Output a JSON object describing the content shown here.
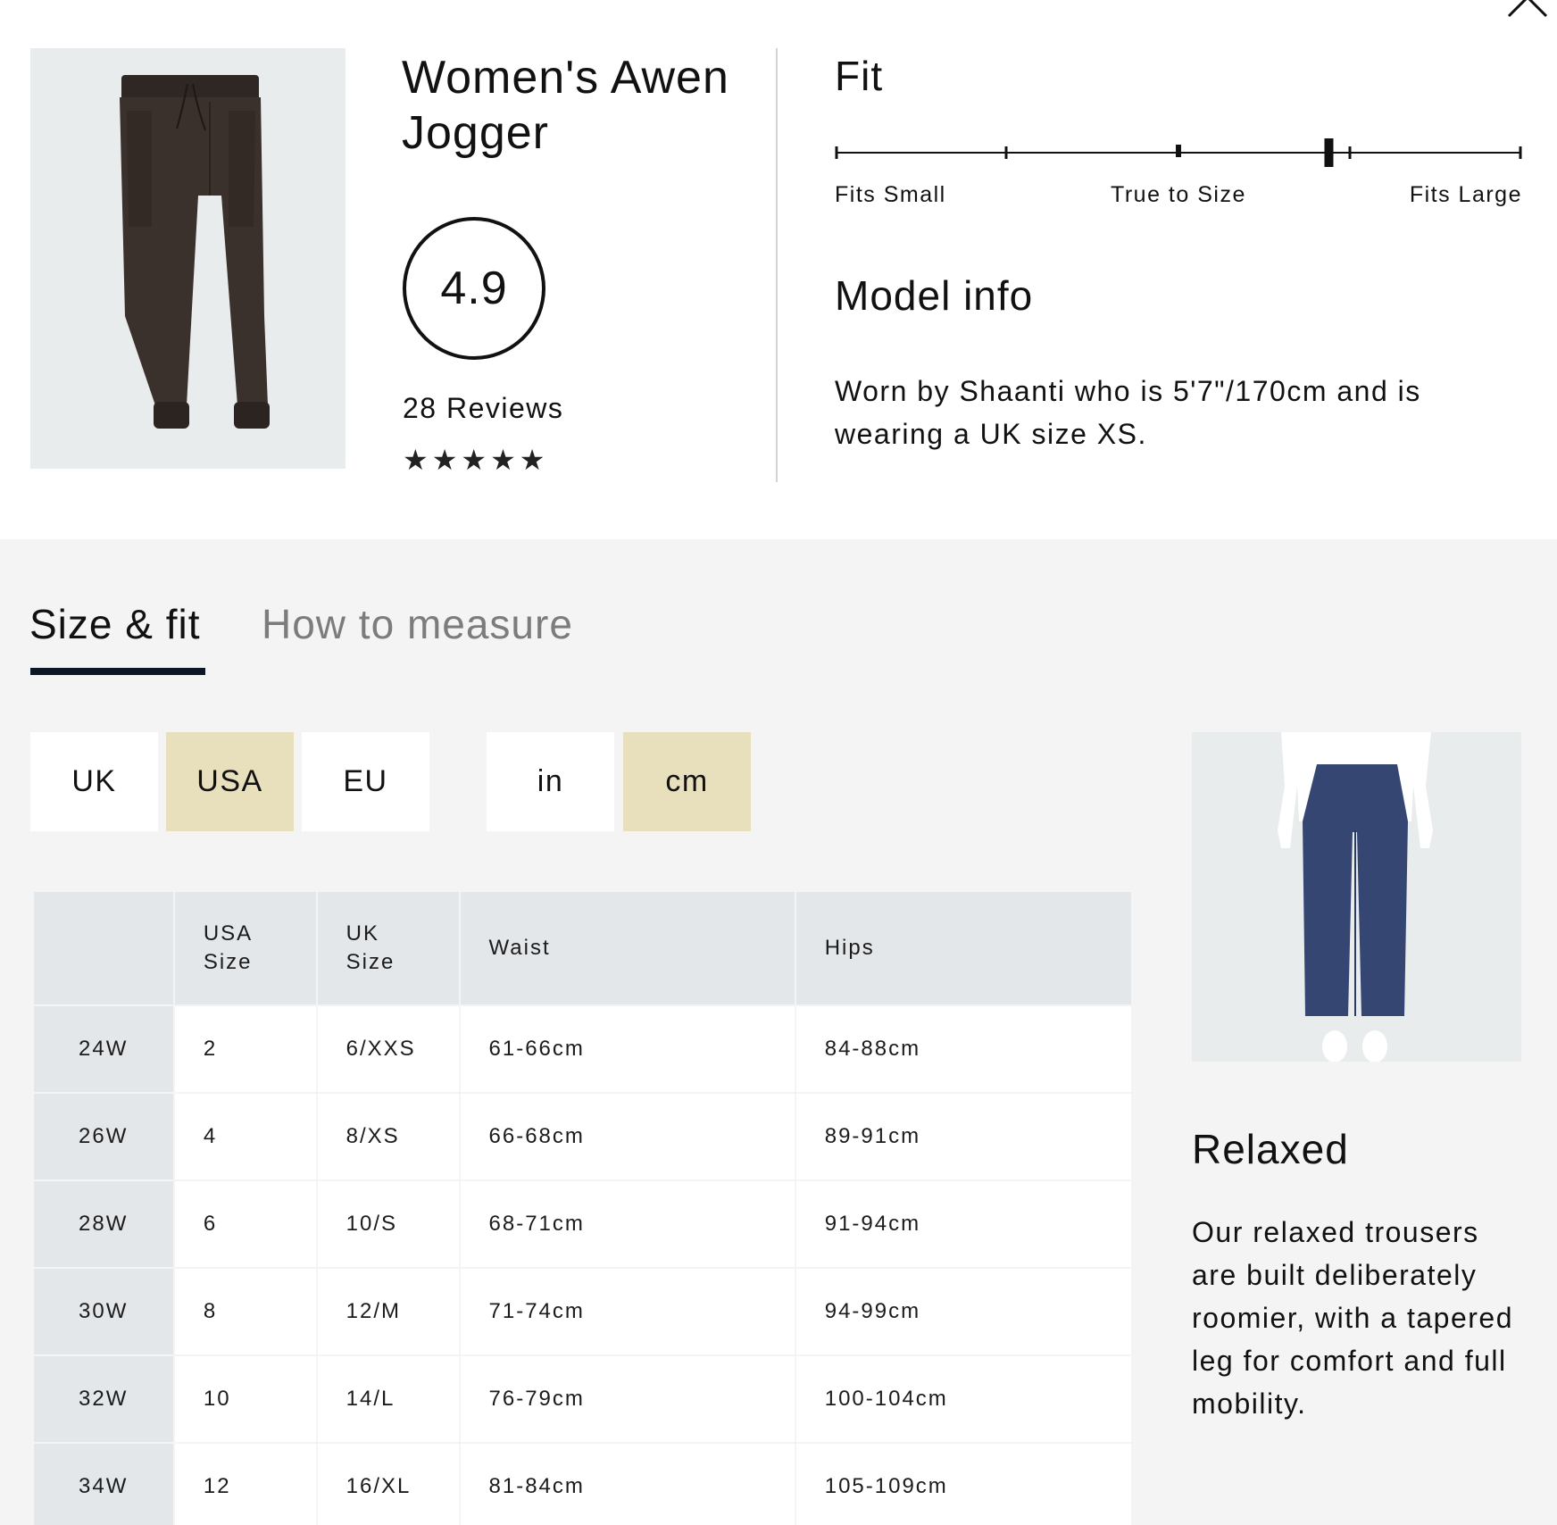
{
  "product": {
    "title": "Women's Awen Jogger",
    "rating": "4.9",
    "review_count": "28 Reviews",
    "stars": 5
  },
  "fit": {
    "heading": "Fit",
    "labels": [
      "Fits Small",
      "True to Size",
      "Fits Large"
    ],
    "position": 0.72
  },
  "model": {
    "heading": "Model info",
    "text": "Worn by Shaanti who is 5'7\"/170cm and is wearing a UK size XS."
  },
  "tabs": [
    {
      "label": "Size & fit",
      "active": true
    },
    {
      "label": "How to measure",
      "active": false
    }
  ],
  "region_toggles": [
    {
      "label": "UK",
      "active": false
    },
    {
      "label": "USA",
      "active": true
    },
    {
      "label": "EU",
      "active": false
    }
  ],
  "unit_toggles": [
    {
      "label": "in",
      "active": false
    },
    {
      "label": "cm",
      "active": true
    }
  ],
  "table": {
    "headers": [
      "",
      "USA\nSize",
      "UK\nSize",
      "Waist",
      "Hips"
    ],
    "rows": [
      [
        "24W",
        "2",
        "6/XXS",
        "61-66cm",
        "84-88cm"
      ],
      [
        "26W",
        "4",
        "8/XS",
        "66-68cm",
        "89-91cm"
      ],
      [
        "28W",
        "6",
        "10/S",
        "68-71cm",
        "91-94cm"
      ],
      [
        "30W",
        "8",
        "12/M",
        "71-74cm",
        "94-99cm"
      ],
      [
        "32W",
        "10",
        "14/L",
        "76-79cm",
        "100-104cm"
      ],
      [
        "34W",
        "12",
        "16/XL",
        "81-84cm",
        "105-109cm"
      ]
    ]
  },
  "fit_type": {
    "heading": "Relaxed",
    "text": "Our relaxed trousers are built deliberately roomier, with a tapered leg for comfort and full mobility."
  },
  "colors": {
    "toggle_active": "#e8dfbd",
    "tab_underline": "#0c1726",
    "table_header_bg": "#e4e7ea",
    "trouser_navy": "#364673",
    "jogger_brown": "#3a302c"
  },
  "icons": [
    "close-icon",
    "star-icon",
    "fit-slider-marker"
  ]
}
